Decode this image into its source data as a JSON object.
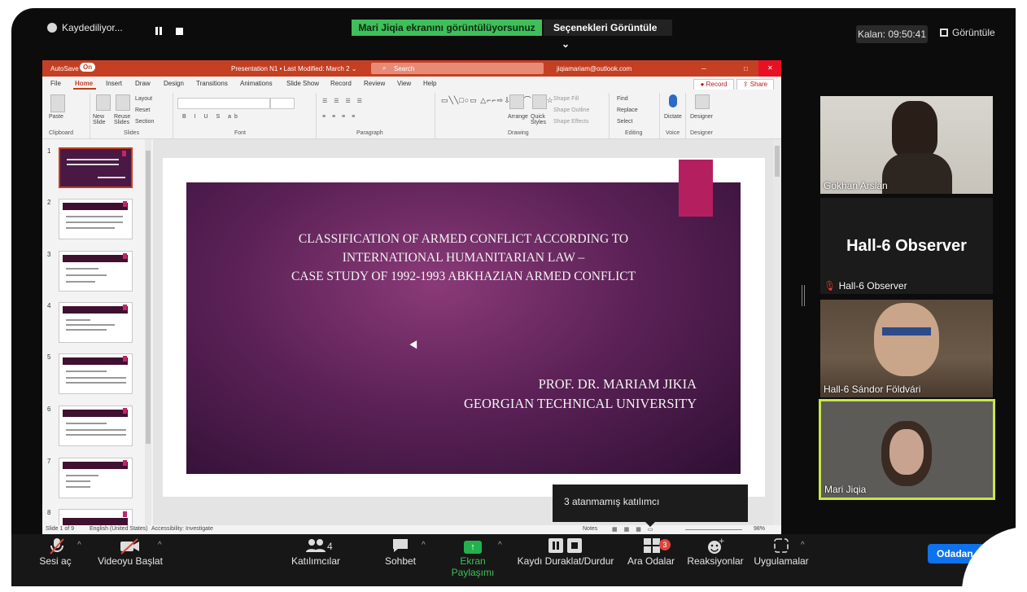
{
  "topbar": {
    "recording_label": "Kaydediliyor...",
    "share_banner": "Mari Jiqia ekranını görüntülüyorsunuz",
    "view_options": "Seçenekleri Görüntüle",
    "view_options_caret": "⌄",
    "timer": "Kalan: 09:50:41",
    "view_button": "Görüntüle"
  },
  "ppt": {
    "title_bar": {
      "autosave": "AutoSave",
      "autosave_state": "On",
      "doc_title": "Presentation N1 • Last Modified: March 2 ⌄",
      "search_placeholder": "Search",
      "account": "jiqiamariam@outlook.com"
    },
    "menu": [
      "File",
      "Home",
      "Insert",
      "Draw",
      "Design",
      "Transitions",
      "Animations",
      "Slide Show",
      "Record",
      "Review",
      "View",
      "Help"
    ],
    "record_button": "Record",
    "share_button": "Share",
    "ribbon": {
      "paste": "Paste",
      "new_slide": "New Slide",
      "reuse_slides": "Reuse Slides",
      "layout": "Layout",
      "reset": "Reset",
      "section": "Section",
      "arrange": "Arrange",
      "quick_styles": "Quick Styles",
      "shape_fill": "Shape Fill",
      "shape_outline": "Shape Outline",
      "shape_effects": "Shape Effects",
      "find": "Find",
      "replace": "Replace",
      "select": "Select",
      "dictate": "Dictate",
      "designer": "Designer",
      "groups": [
        "Clipboard",
        "Slides",
        "Font",
        "Paragraph",
        "Drawing",
        "Editing",
        "Voice",
        "Designer"
      ]
    },
    "thumb_numbers": [
      "1",
      "2",
      "3",
      "4",
      "5",
      "6",
      "7",
      "8"
    ],
    "slide": {
      "title_line1": "CLASSIFICATION OF ARMED CONFLICT ACCORDING TO",
      "title_line2": "INTERNATIONAL HUMANITARIAN LAW –",
      "title_line3": "CASE STUDY OF 1992-1993 ABKHAZIAN ARMED CONFLICT",
      "author": "PROF. DR. MARIAM JIKIA",
      "affiliation": "GEORGIAN TECHNICAL UNIVERSITY"
    },
    "status": {
      "slide_count": "Slide 1 of 9",
      "language": "English (United States)",
      "accessibility": "Accessibility: Investigate",
      "notes": "Notes",
      "zoom": "98%"
    }
  },
  "tooltip": "3 atanmamış katılımcı",
  "participants": [
    {
      "name": "Gökhan Arslan"
    },
    {
      "name": "Hall-6 Observer",
      "big_label": "Hall-6 Observer"
    },
    {
      "name": "Hall-6 Sándor Földvári"
    },
    {
      "name": "Mari Jiqia"
    }
  ],
  "toolbar": {
    "unmute": "Sesi aç",
    "start_video": "Videoyu Başlat",
    "participants": "Katılımcılar",
    "participants_count": "4",
    "chat": "Sohbet",
    "share_screen": "Ekran Paylaşımı",
    "pause_recording": "Kaydı Duraklat/Durdur",
    "breakout_rooms": "Ara Odalar",
    "breakout_badge": "3",
    "reactions": "Reaksiyonlar",
    "apps": "Uygulamalar",
    "leave": "Odadan"
  },
  "colors": {
    "share_green": "#3fbf5a",
    "ppt_red": "#c53f22",
    "active_border": "#c8e64a",
    "leave_blue": "#0e72ed"
  }
}
